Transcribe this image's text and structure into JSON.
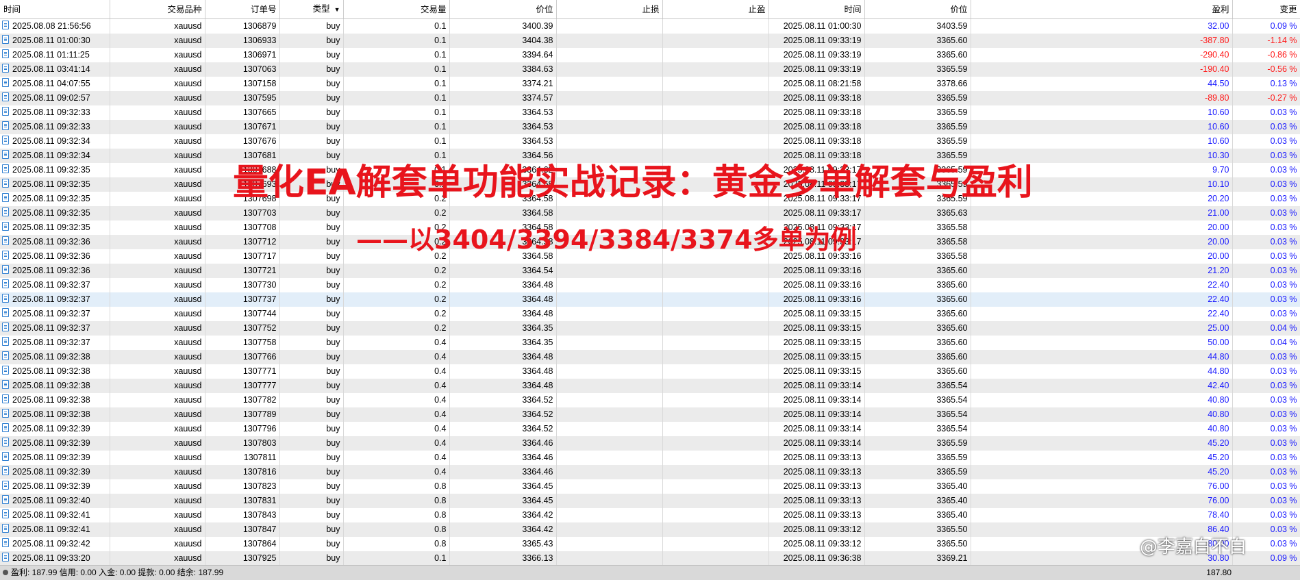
{
  "columns": {
    "open_time": "时间",
    "symbol": "交易品种",
    "ticket": "订单号",
    "type": "类型",
    "volume": "交易量",
    "open_price": "价位",
    "sl": "止损",
    "tp": "止盈",
    "close_time": "时间",
    "close_price": "价位",
    "profit": "盈利",
    "change": "变更"
  },
  "rows": [
    [
      "2025.08.08 21:56:56",
      "xauusd",
      "1306879",
      "buy",
      "0.1",
      "3400.39",
      "",
      "",
      "2025.08.11 01:00:30",
      "3403.59",
      "32.00",
      "0.09 %"
    ],
    [
      "2025.08.11 01:00:30",
      "xauusd",
      "1306933",
      "buy",
      "0.1",
      "3404.38",
      "",
      "",
      "2025.08.11 09:33:19",
      "3365.60",
      "-387.80",
      "-1.14 %"
    ],
    [
      "2025.08.11 01:11:25",
      "xauusd",
      "1306971",
      "buy",
      "0.1",
      "3394.64",
      "",
      "",
      "2025.08.11 09:33:19",
      "3365.60",
      "-290.40",
      "-0.86 %"
    ],
    [
      "2025.08.11 03:41:14",
      "xauusd",
      "1307063",
      "buy",
      "0.1",
      "3384.63",
      "",
      "",
      "2025.08.11 09:33:19",
      "3365.59",
      "-190.40",
      "-0.56 %"
    ],
    [
      "2025.08.11 04:07:55",
      "xauusd",
      "1307158",
      "buy",
      "0.1",
      "3374.21",
      "",
      "",
      "2025.08.11 08:21:58",
      "3378.66",
      "44.50",
      "0.13 %"
    ],
    [
      "2025.08.11 09:02:57",
      "xauusd",
      "1307595",
      "buy",
      "0.1",
      "3374.57",
      "",
      "",
      "2025.08.11 09:33:18",
      "3365.59",
      "-89.80",
      "-0.27 %"
    ],
    [
      "2025.08.11 09:32:33",
      "xauusd",
      "1307665",
      "buy",
      "0.1",
      "3364.53",
      "",
      "",
      "2025.08.11 09:33:18",
      "3365.59",
      "10.60",
      "0.03 %"
    ],
    [
      "2025.08.11 09:32:33",
      "xauusd",
      "1307671",
      "buy",
      "0.1",
      "3364.53",
      "",
      "",
      "2025.08.11 09:33:18",
      "3365.59",
      "10.60",
      "0.03 %"
    ],
    [
      "2025.08.11 09:32:34",
      "xauusd",
      "1307676",
      "buy",
      "0.1",
      "3364.53",
      "",
      "",
      "2025.08.11 09:33:18",
      "3365.59",
      "10.60",
      "0.03 %"
    ],
    [
      "2025.08.11 09:32:34",
      "xauusd",
      "1307681",
      "buy",
      "0.1",
      "3364.56",
      "",
      "",
      "2025.08.11 09:33:18",
      "3365.59",
      "10.30",
      "0.03 %"
    ],
    [
      "2025.08.11 09:32:35",
      "xauusd",
      "1307688",
      "buy",
      "0.1",
      "3364.62",
      "",
      "",
      "2025.08.11 09:33:17",
      "3365.59",
      "9.70",
      "0.03 %"
    ],
    [
      "2025.08.11 09:32:35",
      "xauusd",
      "1307693",
      "buy",
      "0.1",
      "3364.58",
      "",
      "",
      "2025.08.11 09:33:17",
      "3365.59",
      "10.10",
      "0.03 %"
    ],
    [
      "2025.08.11 09:32:35",
      "xauusd",
      "1307698",
      "buy",
      "0.2",
      "3364.58",
      "",
      "",
      "2025.08.11 09:33:17",
      "3365.59",
      "20.20",
      "0.03 %"
    ],
    [
      "2025.08.11 09:32:35",
      "xauusd",
      "1307703",
      "buy",
      "0.2",
      "3364.58",
      "",
      "",
      "2025.08.11 09:33:17",
      "3365.63",
      "21.00",
      "0.03 %"
    ],
    [
      "2025.08.11 09:32:35",
      "xauusd",
      "1307708",
      "buy",
      "0.2",
      "3364.58",
      "",
      "",
      "2025.08.11 09:33:17",
      "3365.58",
      "20.00",
      "0.03 %"
    ],
    [
      "2025.08.11 09:32:36",
      "xauusd",
      "1307712",
      "buy",
      "0.2",
      "3364.58",
      "",
      "",
      "2025.08.11 09:33:17",
      "3365.58",
      "20.00",
      "0.03 %"
    ],
    [
      "2025.08.11 09:32:36",
      "xauusd",
      "1307717",
      "buy",
      "0.2",
      "3364.58",
      "",
      "",
      "2025.08.11 09:33:16",
      "3365.58",
      "20.00",
      "0.03 %"
    ],
    [
      "2025.08.11 09:32:36",
      "xauusd",
      "1307721",
      "buy",
      "0.2",
      "3364.54",
      "",
      "",
      "2025.08.11 09:33:16",
      "3365.60",
      "21.20",
      "0.03 %"
    ],
    [
      "2025.08.11 09:32:37",
      "xauusd",
      "1307730",
      "buy",
      "0.2",
      "3364.48",
      "",
      "",
      "2025.08.11 09:33:16",
      "3365.60",
      "22.40",
      "0.03 %"
    ],
    [
      "2025.08.11 09:32:37",
      "xauusd",
      "1307737",
      "buy",
      "0.2",
      "3364.48",
      "",
      "",
      "2025.08.11 09:33:16",
      "3365.60",
      "22.40",
      "0.03 %"
    ],
    [
      "2025.08.11 09:32:37",
      "xauusd",
      "1307744",
      "buy",
      "0.2",
      "3364.48",
      "",
      "",
      "2025.08.11 09:33:15",
      "3365.60",
      "22.40",
      "0.03 %"
    ],
    [
      "2025.08.11 09:32:37",
      "xauusd",
      "1307752",
      "buy",
      "0.2",
      "3364.35",
      "",
      "",
      "2025.08.11 09:33:15",
      "3365.60",
      "25.00",
      "0.04 %"
    ],
    [
      "2025.08.11 09:32:37",
      "xauusd",
      "1307758",
      "buy",
      "0.4",
      "3364.35",
      "",
      "",
      "2025.08.11 09:33:15",
      "3365.60",
      "50.00",
      "0.04 %"
    ],
    [
      "2025.08.11 09:32:38",
      "xauusd",
      "1307766",
      "buy",
      "0.4",
      "3364.48",
      "",
      "",
      "2025.08.11 09:33:15",
      "3365.60",
      "44.80",
      "0.03 %"
    ],
    [
      "2025.08.11 09:32:38",
      "xauusd",
      "1307771",
      "buy",
      "0.4",
      "3364.48",
      "",
      "",
      "2025.08.11 09:33:15",
      "3365.60",
      "44.80",
      "0.03 %"
    ],
    [
      "2025.08.11 09:32:38",
      "xauusd",
      "1307777",
      "buy",
      "0.4",
      "3364.48",
      "",
      "",
      "2025.08.11 09:33:14",
      "3365.54",
      "42.40",
      "0.03 %"
    ],
    [
      "2025.08.11 09:32:38",
      "xauusd",
      "1307782",
      "buy",
      "0.4",
      "3364.52",
      "",
      "",
      "2025.08.11 09:33:14",
      "3365.54",
      "40.80",
      "0.03 %"
    ],
    [
      "2025.08.11 09:32:38",
      "xauusd",
      "1307789",
      "buy",
      "0.4",
      "3364.52",
      "",
      "",
      "2025.08.11 09:33:14",
      "3365.54",
      "40.80",
      "0.03 %"
    ],
    [
      "2025.08.11 09:32:39",
      "xauusd",
      "1307796",
      "buy",
      "0.4",
      "3364.52",
      "",
      "",
      "2025.08.11 09:33:14",
      "3365.54",
      "40.80",
      "0.03 %"
    ],
    [
      "2025.08.11 09:32:39",
      "xauusd",
      "1307803",
      "buy",
      "0.4",
      "3364.46",
      "",
      "",
      "2025.08.11 09:33:14",
      "3365.59",
      "45.20",
      "0.03 %"
    ],
    [
      "2025.08.11 09:32:39",
      "xauusd",
      "1307811",
      "buy",
      "0.4",
      "3364.46",
      "",
      "",
      "2025.08.11 09:33:13",
      "3365.59",
      "45.20",
      "0.03 %"
    ],
    [
      "2025.08.11 09:32:39",
      "xauusd",
      "1307816",
      "buy",
      "0.4",
      "3364.46",
      "",
      "",
      "2025.08.11 09:33:13",
      "3365.59",
      "45.20",
      "0.03 %"
    ],
    [
      "2025.08.11 09:32:39",
      "xauusd",
      "1307823",
      "buy",
      "0.8",
      "3364.45",
      "",
      "",
      "2025.08.11 09:33:13",
      "3365.40",
      "76.00",
      "0.03 %"
    ],
    [
      "2025.08.11 09:32:40",
      "xauusd",
      "1307831",
      "buy",
      "0.8",
      "3364.45",
      "",
      "",
      "2025.08.11 09:33:13",
      "3365.40",
      "76.00",
      "0.03 %"
    ],
    [
      "2025.08.11 09:32:41",
      "xauusd",
      "1307843",
      "buy",
      "0.8",
      "3364.42",
      "",
      "",
      "2025.08.11 09:33:13",
      "3365.40",
      "78.40",
      "0.03 %"
    ],
    [
      "2025.08.11 09:32:41",
      "xauusd",
      "1307847",
      "buy",
      "0.8",
      "3364.42",
      "",
      "",
      "2025.08.11 09:33:12",
      "3365.50",
      "86.40",
      "0.03 %"
    ],
    [
      "2025.08.11 09:32:42",
      "xauusd",
      "1307864",
      "buy",
      "0.8",
      "3365.43",
      "",
      "",
      "2025.08.11 09:33:12",
      "3365.50",
      "80.00",
      "0.03 %"
    ],
    [
      "2025.08.11 09:33:20",
      "xauusd",
      "1307925",
      "buy",
      "0.1",
      "3366.13",
      "",
      "",
      "2025.08.11 09:36:38",
      "3369.21",
      "30.80",
      "0.09 %"
    ]
  ],
  "selected_row": 19,
  "colors": {
    "positive": "#1a1aff",
    "negative": "#ff1a1a",
    "overlay": "#e8141c"
  },
  "overlay": {
    "title": "量化EA解套单功能实战记录：黄金多单解套与盈利",
    "subtitle": "——以3404/3394/3384/3374多单为例"
  },
  "footer": {
    "summary": "盈利: 187.99  信用: 0.00  入金: 0.00  提款: 0.00  结余: 187.99",
    "total_profit": "187.80"
  },
  "watermark": "@李嘉白不白",
  "icons": {
    "row": "document-icon",
    "sort": "sort-down-icon",
    "footer": "status-dot-icon"
  }
}
